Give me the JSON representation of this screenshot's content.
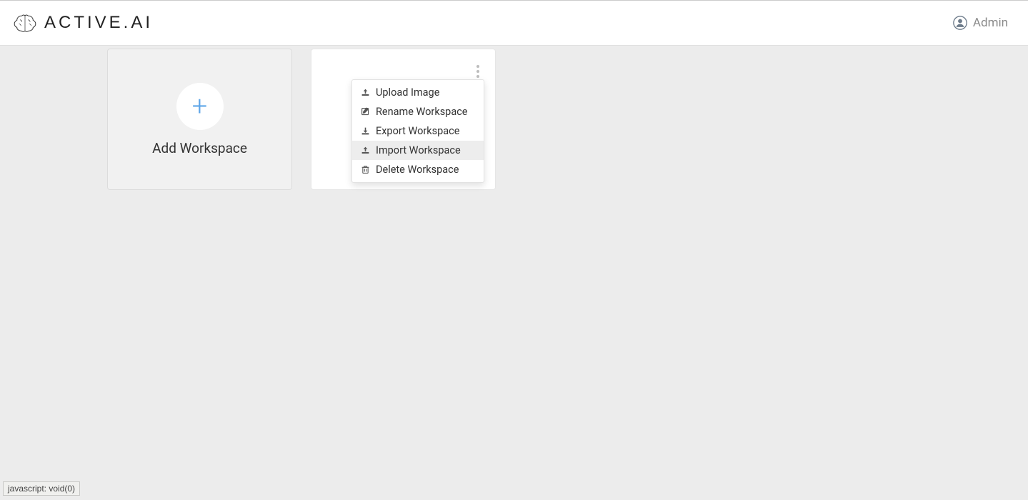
{
  "header": {
    "brand": "ACTIVE.AI",
    "user_name": "Admin"
  },
  "cards": {
    "add_label": "Add Workspace"
  },
  "menu": {
    "items": [
      {
        "label": "Upload Image",
        "icon": "upload",
        "hovered": false
      },
      {
        "label": "Rename Workspace",
        "icon": "edit",
        "hovered": false
      },
      {
        "label": "Export Workspace",
        "icon": "download",
        "hovered": false
      },
      {
        "label": "Import Workspace",
        "icon": "upload",
        "hovered": true
      },
      {
        "label": "Delete Workspace",
        "icon": "trash",
        "hovered": false
      }
    ]
  },
  "status": {
    "text": "javascript: void(0)"
  }
}
